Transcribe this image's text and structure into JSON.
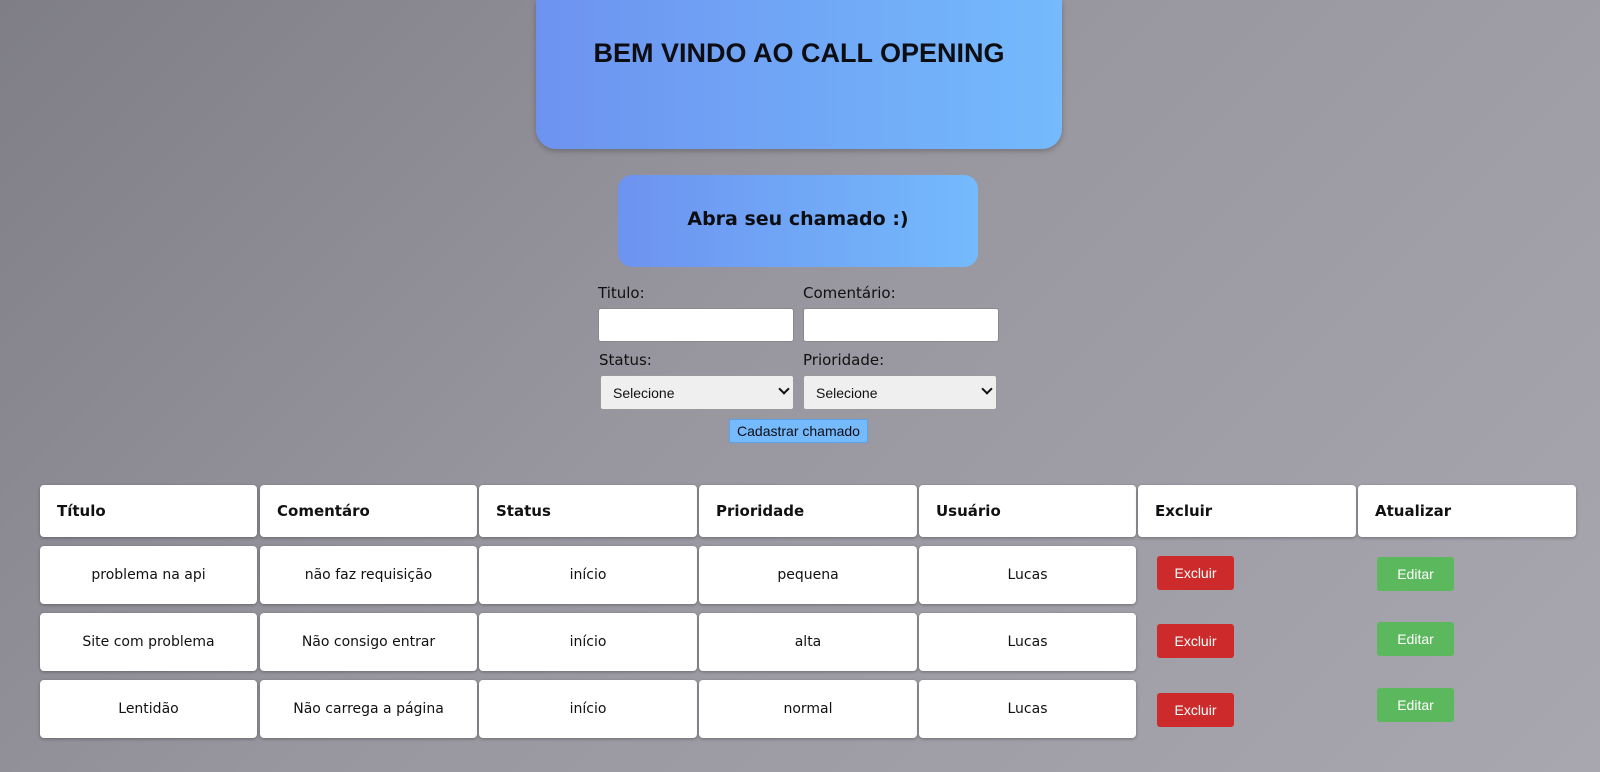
{
  "header": {
    "title": "BEM VINDO AO CALL OPENING",
    "subtitle": "Abra seu chamado :)"
  },
  "form": {
    "titulo_label": "Titulo:",
    "titulo_value": "",
    "comentario_label": "Comentário:",
    "comentario_value": "",
    "status_label": "Status:",
    "status_selected": "Selecione",
    "prioridade_label": "Prioridade:",
    "prioridade_selected": "Selecione",
    "submit_label": "Cadastrar chamado"
  },
  "table": {
    "headers": [
      "Título",
      "Comentáro",
      "Status",
      "Prioridade",
      "Usuário",
      "Excluir",
      "Atualizar"
    ],
    "rows": [
      {
        "titulo": "problema na api",
        "comentario": "não faz requisição",
        "status": "início",
        "prioridade": "pequena",
        "usuario": "Lucas",
        "excluir": "Excluir",
        "editar": "Editar"
      },
      {
        "titulo": "Site com problema",
        "comentario": "Não consigo entrar",
        "status": "início",
        "prioridade": "alta",
        "usuario": "Lucas",
        "excluir": "Excluir",
        "editar": "Editar"
      },
      {
        "titulo": "Lentidão",
        "comentario": "Não carrega a página",
        "status": "início",
        "prioridade": "normal",
        "usuario": "Lucas",
        "excluir": "Excluir",
        "editar": "Editar"
      }
    ]
  },
  "colors": {
    "accent_blue": "#74bafc",
    "gradient_start": "#6d93f0",
    "delete_red": "#cd2b2b",
    "edit_green": "#5cb85c"
  }
}
